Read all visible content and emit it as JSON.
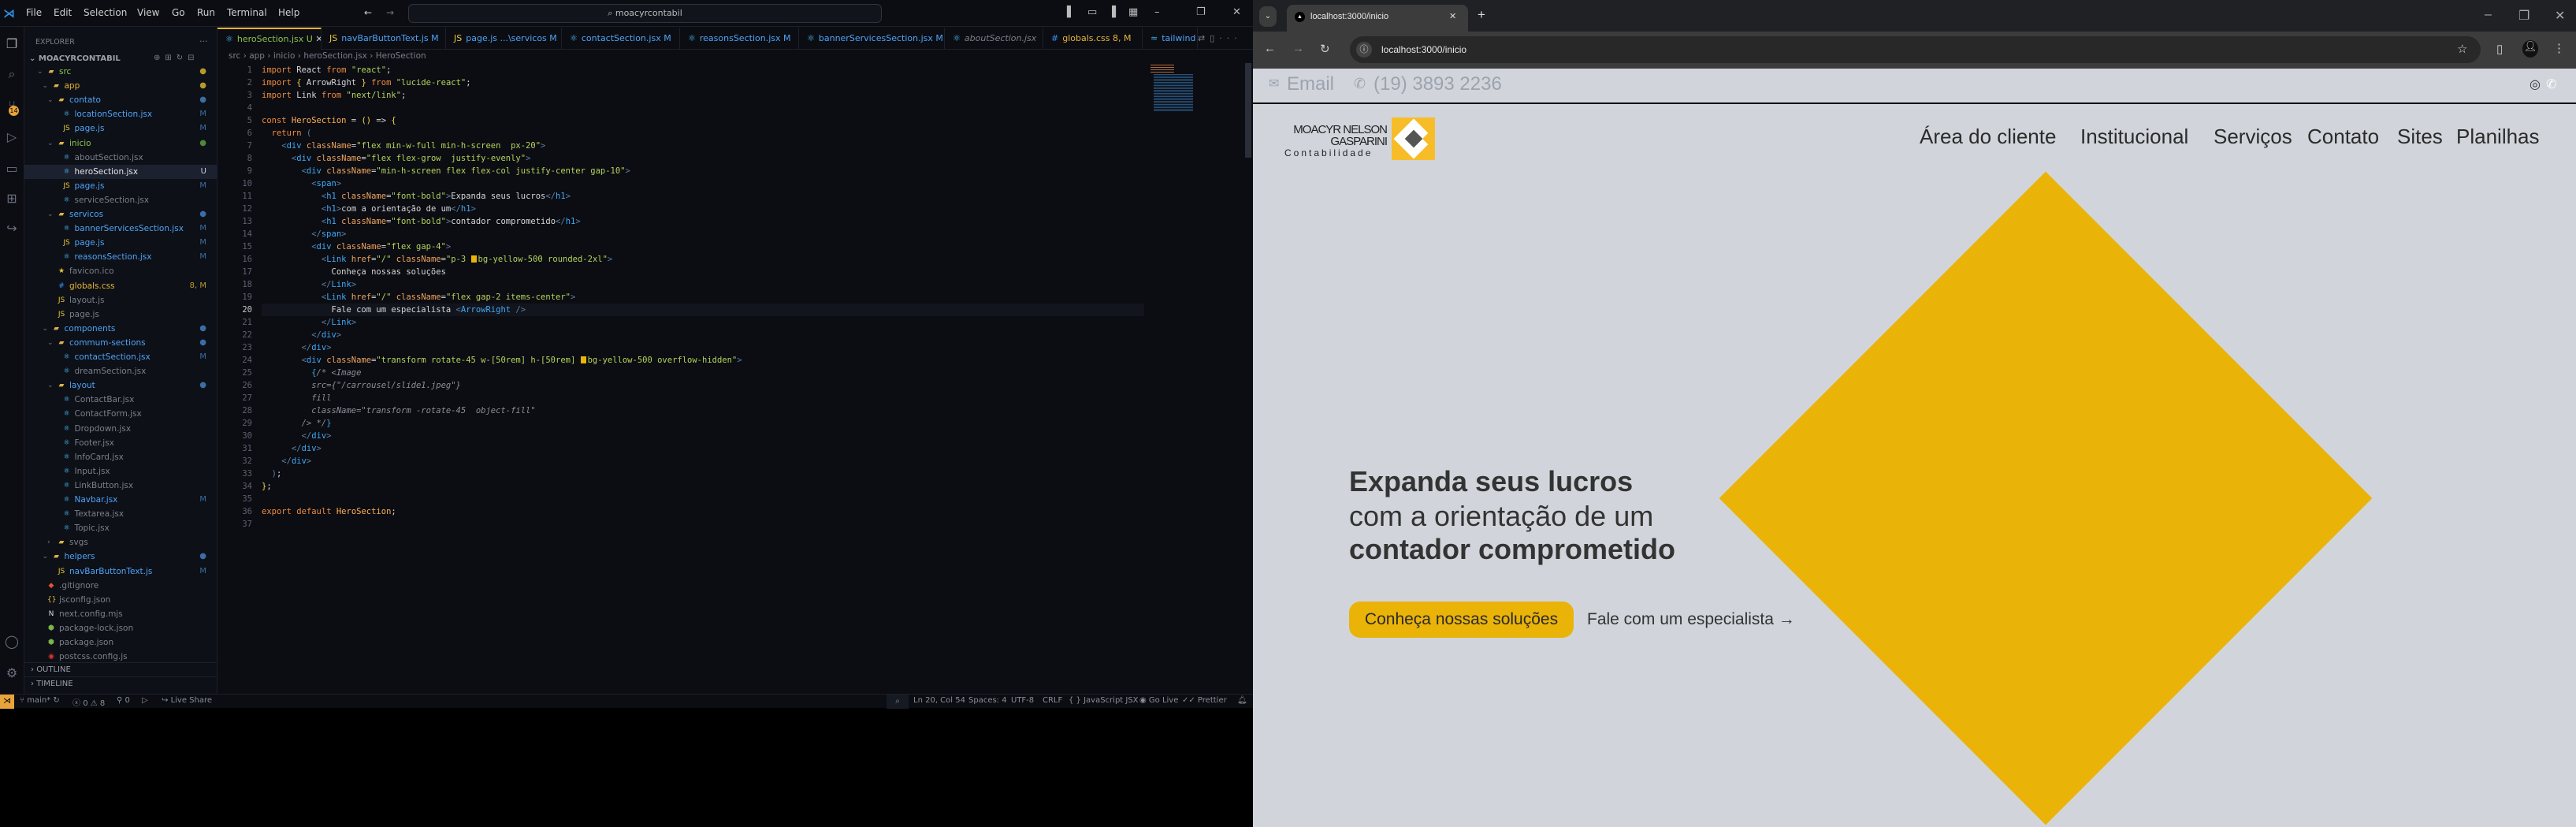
{
  "vscode": {
    "menu": [
      "File",
      "Edit",
      "Selection",
      "View",
      "Go",
      "Run",
      "Terminal",
      "Help"
    ],
    "command_center": "moacyrcontabil",
    "explorer_title": "EXPLORER",
    "project": "MOACYRCONTABIL",
    "tree": [
      {
        "label": "src",
        "depth": 0,
        "kind": "folder",
        "color": "#8bc34a",
        "badge": "●",
        "badge_color": "#b59a2a"
      },
      {
        "label": "app",
        "depth": 1,
        "kind": "folder",
        "color": "#e8b339",
        "badge": "●",
        "badge_color": "#b59a2a"
      },
      {
        "label": "contato",
        "depth": 2,
        "kind": "folder",
        "color": "#4fa3f7",
        "badge": "●",
        "badge_color": "#3a6ea5"
      },
      {
        "label": "locationSection.jsx",
        "depth": 3,
        "kind": "jsx",
        "color": "#4fa3f7",
        "badge": "M",
        "badge_color": "#3a6ea5"
      },
      {
        "label": "page.js",
        "depth": 3,
        "kind": "js",
        "color": "#4fa3f7",
        "badge": "M",
        "badge_color": "#3a6ea5"
      },
      {
        "label": "inicio",
        "depth": 2,
        "kind": "folder",
        "color": "#8bc34a",
        "badge": "●",
        "badge_color": "#4c8a3a"
      },
      {
        "label": "aboutSection.jsx",
        "depth": 3,
        "kind": "jsx",
        "color": "#7a7f8a",
        "badge": "",
        "badge_color": ""
      },
      {
        "label": "heroSection.jsx",
        "depth": 3,
        "kind": "jsx",
        "color": "#e6e6e6",
        "badge": "U",
        "badge_color": "#cfcfcf",
        "selected": true
      },
      {
        "label": "page.js",
        "depth": 3,
        "kind": "js",
        "color": "#4fa3f7",
        "badge": "M",
        "badge_color": "#3a6ea5"
      },
      {
        "label": "serviceSection.jsx",
        "depth": 3,
        "kind": "jsx",
        "color": "#7a7f8a",
        "badge": "",
        "badge_color": ""
      },
      {
        "label": "servicos",
        "depth": 2,
        "kind": "folder",
        "color": "#4fa3f7",
        "badge": "●",
        "badge_color": "#3a6ea5"
      },
      {
        "label": "bannerServicesSection.jsx",
        "depth": 3,
        "kind": "jsx",
        "color": "#4fa3f7",
        "badge": "M",
        "badge_color": "#3a6ea5"
      },
      {
        "label": "page.js",
        "depth": 3,
        "kind": "js",
        "color": "#4fa3f7",
        "badge": "M",
        "badge_color": "#3a6ea5"
      },
      {
        "label": "reasonsSection.jsx",
        "depth": 3,
        "kind": "jsx",
        "color": "#4fa3f7",
        "badge": "M",
        "badge_color": "#3a6ea5"
      },
      {
        "label": "favicon.ico",
        "depth": 2,
        "kind": "star",
        "color": "#7a7f8a",
        "badge": "",
        "badge_color": ""
      },
      {
        "label": "globals.css",
        "depth": 2,
        "kind": "css",
        "color": "#e8b339",
        "badge": "8, M",
        "badge_color": "#b59a2a"
      },
      {
        "label": "layout.js",
        "depth": 2,
        "kind": "js",
        "color": "#7a7f8a",
        "badge": "",
        "badge_color": ""
      },
      {
        "label": "page.js",
        "depth": 2,
        "kind": "js",
        "color": "#7a7f8a",
        "badge": "",
        "badge_color": ""
      },
      {
        "label": "components",
        "depth": 1,
        "kind": "folder",
        "color": "#4fa3f7",
        "badge": "●",
        "badge_color": "#3a6ea5"
      },
      {
        "label": "commum-sections",
        "depth": 2,
        "kind": "folder",
        "color": "#4fa3f7",
        "badge": "●",
        "badge_color": "#3a6ea5"
      },
      {
        "label": "contactSection.jsx",
        "depth": 3,
        "kind": "jsx",
        "color": "#4fa3f7",
        "badge": "M",
        "badge_color": "#3a6ea5"
      },
      {
        "label": "dreamSection.jsx",
        "depth": 3,
        "kind": "jsx",
        "color": "#7a7f8a",
        "badge": "",
        "badge_color": ""
      },
      {
        "label": "layout",
        "depth": 2,
        "kind": "folder",
        "color": "#4fa3f7",
        "badge": "●",
        "badge_color": "#3a6ea5"
      },
      {
        "label": "ContactBar.jsx",
        "depth": 3,
        "kind": "jsx",
        "color": "#7a7f8a",
        "badge": "",
        "badge_color": ""
      },
      {
        "label": "ContactForm.jsx",
        "depth": 3,
        "kind": "jsx",
        "color": "#7a7f8a",
        "badge": "",
        "badge_color": ""
      },
      {
        "label": "Dropdown.jsx",
        "depth": 3,
        "kind": "jsx",
        "color": "#7a7f8a",
        "badge": "",
        "badge_color": ""
      },
      {
        "label": "Footer.jsx",
        "depth": 3,
        "kind": "jsx",
        "color": "#7a7f8a",
        "badge": "",
        "badge_color": ""
      },
      {
        "label": "InfoCard.jsx",
        "depth": 3,
        "kind": "jsx",
        "color": "#7a7f8a",
        "badge": "",
        "badge_color": ""
      },
      {
        "label": "Input.jsx",
        "depth": 3,
        "kind": "jsx",
        "color": "#7a7f8a",
        "badge": "",
        "badge_color": ""
      },
      {
        "label": "LinkButton.jsx",
        "depth": 3,
        "kind": "jsx",
        "color": "#7a7f8a",
        "badge": "",
        "badge_color": ""
      },
      {
        "label": "Navbar.jsx",
        "depth": 3,
        "kind": "jsx",
        "color": "#4fa3f7",
        "badge": "M",
        "badge_color": "#3a6ea5"
      },
      {
        "label": "Textarea.jsx",
        "depth": 3,
        "kind": "jsx",
        "color": "#7a7f8a",
        "badge": "",
        "badge_color": ""
      },
      {
        "label": "Topic.jsx",
        "depth": 3,
        "kind": "jsx",
        "color": "#7a7f8a",
        "badge": "",
        "badge_color": ""
      },
      {
        "label": "svgs",
        "depth": 2,
        "kind": "folder-closed",
        "color": "#7a7f8a",
        "badge": "",
        "badge_color": ""
      },
      {
        "label": "helpers",
        "depth": 1,
        "kind": "folder",
        "color": "#4fa3f7",
        "badge": "●",
        "badge_color": "#3a6ea5"
      },
      {
        "label": "navBarButtonText.js",
        "depth": 2,
        "kind": "js",
        "color": "#4fa3f7",
        "badge": "M",
        "badge_color": "#3a6ea5"
      },
      {
        "label": ".gitignore",
        "depth": 0,
        "kind": "git",
        "color": "#7a7f8a",
        "badge": "",
        "badge_color": ""
      },
      {
        "label": "jsconfig.json",
        "depth": 0,
        "kind": "json",
        "color": "#7a7f8a",
        "badge": "",
        "badge_color": ""
      },
      {
        "label": "next.config.mjs",
        "depth": 0,
        "kind": "next",
        "color": "#7a7f8a",
        "badge": "",
        "badge_color": ""
      },
      {
        "label": "package-lock.json",
        "depth": 0,
        "kind": "npm",
        "color": "#7a7f8a",
        "badge": "",
        "badge_color": ""
      },
      {
        "label": "package.json",
        "depth": 0,
        "kind": "npm",
        "color": "#7a7f8a",
        "badge": "",
        "badge_color": ""
      },
      {
        "label": "postcss.config.js",
        "depth": 0,
        "kind": "postcss",
        "color": "#7a7f8a",
        "badge": "",
        "badge_color": ""
      }
    ],
    "outline": "OUTLINE",
    "timeline": "TIMELINE",
    "source_control_badge": "14",
    "tabs": [
      {
        "label": "heroSection.jsx U",
        "kind": "jsx",
        "color": "#8bc34a",
        "active": true
      },
      {
        "label": "navBarButtonText.js M",
        "kind": "js",
        "color": "#4fa3f7"
      },
      {
        "label": "page.js ...\\servicos M",
        "kind": "js",
        "color": "#4fa3f7"
      },
      {
        "label": "contactSection.jsx M",
        "kind": "jsx",
        "color": "#4fa3f7"
      },
      {
        "label": "reasonsSection.jsx M",
        "kind": "jsx",
        "color": "#4fa3f7"
      },
      {
        "label": "bannerServicesSection.jsx M",
        "kind": "jsx",
        "color": "#4fa3f7"
      },
      {
        "label": "aboutSection.jsx",
        "kind": "jsx",
        "color": "#7a7f8a"
      },
      {
        "label": "globals.css 8, M",
        "kind": "css",
        "color": "#e8b339"
      },
      {
        "label": "tailwind",
        "kind": "tw",
        "color": "#4fa3f7"
      }
    ],
    "breadcrumb": "src › app › inicio › heroSection.jsx › HeroSection",
    "code": [
      [
        [
          "import",
          "k"
        ],
        [
          " React ",
          "i"
        ],
        [
          "from",
          "k"
        ],
        [
          " \"react\"",
          "s"
        ],
        [
          ";",
          "i"
        ]
      ],
      [
        [
          "import",
          "k"
        ],
        [
          " ",
          "i"
        ],
        [
          "{",
          "y"
        ],
        [
          " ArrowRight ",
          "i"
        ],
        [
          "}",
          "y"
        ],
        [
          " ",
          "i"
        ],
        [
          "from",
          "k"
        ],
        [
          " \"lucide-react\"",
          "s"
        ],
        [
          ";",
          "i"
        ]
      ],
      [
        [
          "import",
          "k"
        ],
        [
          " Link ",
          "i"
        ],
        [
          "from",
          "k"
        ],
        [
          " \"next/link\"",
          "s"
        ],
        [
          ";",
          "i"
        ]
      ],
      [],
      [
        [
          "const",
          "k"
        ],
        [
          " HeroSection",
          "f"
        ],
        [
          " = ",
          "i"
        ],
        [
          "()",
          "y"
        ],
        [
          " => ",
          "i"
        ],
        [
          "{",
          "y"
        ]
      ],
      [
        [
          "  ",
          "i"
        ],
        [
          "return",
          "k"
        ],
        [
          " (",
          "p"
        ]
      ],
      [
        [
          "    <",
          "p"
        ],
        [
          "div",
          "t"
        ],
        [
          " className",
          "a"
        ],
        [
          "=",
          "i"
        ],
        [
          "\"flex min-w-full min-h-screen  px-20\"",
          "s"
        ],
        [
          ">",
          "p"
        ]
      ],
      [
        [
          "      <",
          "p"
        ],
        [
          "div",
          "t"
        ],
        [
          " className",
          "a"
        ],
        [
          "=",
          "i"
        ],
        [
          "\"flex flex-grow  justify-evenly\"",
          "s"
        ],
        [
          ">",
          "p"
        ]
      ],
      [
        [
          "        <",
          "p"
        ],
        [
          "div",
          "t"
        ],
        [
          " className",
          "a"
        ],
        [
          "=",
          "i"
        ],
        [
          "\"min-h-screen flex flex-col justify-center gap-10\"",
          "s"
        ],
        [
          ">",
          "p"
        ]
      ],
      [
        [
          "          <",
          "p"
        ],
        [
          "span",
          "t"
        ],
        [
          ">",
          "p"
        ]
      ],
      [
        [
          "            <",
          "p"
        ],
        [
          "h1",
          "t"
        ],
        [
          " className",
          "a"
        ],
        [
          "=",
          "i"
        ],
        [
          "\"font-bold\"",
          "s"
        ],
        [
          ">",
          "p"
        ],
        [
          "Expanda seus lucros",
          "x"
        ],
        [
          "</",
          "p"
        ],
        [
          "h1",
          "t"
        ],
        [
          ">",
          "p"
        ]
      ],
      [
        [
          "            <",
          "p"
        ],
        [
          "h1",
          "t"
        ],
        [
          ">",
          "p"
        ],
        [
          "com a orientação de um",
          "x"
        ],
        [
          "</",
          "p"
        ],
        [
          "h1",
          "t"
        ],
        [
          ">",
          "p"
        ]
      ],
      [
        [
          "            <",
          "p"
        ],
        [
          "h1",
          "t"
        ],
        [
          " className",
          "a"
        ],
        [
          "=",
          "i"
        ],
        [
          "\"font-bold\"",
          "s"
        ],
        [
          ">",
          "p"
        ],
        [
          "contador comprometido",
          "x"
        ],
        [
          "</",
          "p"
        ],
        [
          "h1",
          "t"
        ],
        [
          ">",
          "p"
        ]
      ],
      [
        [
          "          </",
          "p"
        ],
        [
          "span",
          "t"
        ],
        [
          ">",
          "p"
        ]
      ],
      [
        [
          "          <",
          "p"
        ],
        [
          "div",
          "t"
        ],
        [
          " className",
          "a"
        ],
        [
          "=",
          "i"
        ],
        [
          "\"flex gap-4\"",
          "s"
        ],
        [
          ">",
          "p"
        ]
      ],
      [
        [
          "            <",
          "p"
        ],
        [
          "Link",
          "t"
        ],
        [
          " href",
          "a"
        ],
        [
          "=",
          "i"
        ],
        [
          "\"/\"",
          "s"
        ],
        [
          " className",
          "a"
        ],
        [
          "=",
          "i"
        ],
        [
          "\"p-3 ",
          "s"
        ],
        [
          "",
          "sw"
        ],
        [
          "bg-yellow-500 rounded-2xl\"",
          "s"
        ],
        [
          ">",
          "p"
        ]
      ],
      [
        [
          "              Conheça nossas soluções",
          "x"
        ]
      ],
      [
        [
          "            </",
          "p"
        ],
        [
          "Link",
          "t"
        ],
        [
          ">",
          "p"
        ]
      ],
      [
        [
          "            <",
          "p"
        ],
        [
          "Link",
          "t"
        ],
        [
          " href",
          "a"
        ],
        [
          "=",
          "i"
        ],
        [
          "\"/\"",
          "s"
        ],
        [
          " className",
          "a"
        ],
        [
          "=",
          "i"
        ],
        [
          "\"flex gap-2 items-center\"",
          "s"
        ],
        [
          ">",
          "p"
        ]
      ],
      [
        [
          "              Fale com um especialista ",
          "x"
        ],
        [
          "<",
          "p"
        ],
        [
          "ArrowRight",
          "t"
        ],
        [
          " />",
          "p"
        ]
      ],
      [
        [
          "            </",
          "p"
        ],
        [
          "Link",
          "t"
        ],
        [
          ">",
          "p"
        ]
      ],
      [
        [
          "          </",
          "p"
        ],
        [
          "div",
          "t"
        ],
        [
          ">",
          "p"
        ]
      ],
      [
        [
          "        </",
          "p"
        ],
        [
          "div",
          "t"
        ],
        [
          ">",
          "p"
        ]
      ],
      [
        [
          "        <",
          "p"
        ],
        [
          "div",
          "t"
        ],
        [
          " className",
          "a"
        ],
        [
          "=",
          "i"
        ],
        [
          "\"transform rotate-45 w-[50rem] h-[50rem] ",
          "s"
        ],
        [
          "",
          "sw"
        ],
        [
          "bg-yellow-500 overflow-hidden\"",
          "s"
        ],
        [
          ">",
          "p"
        ]
      ],
      [
        [
          "          {",
          "t"
        ],
        [
          "/* <Image",
          "c"
        ]
      ],
      [
        [
          "          src={\"/carrousel/slide1.jpeg\"}",
          "c"
        ]
      ],
      [
        [
          "          fill",
          "c"
        ]
      ],
      [
        [
          "          className=\"transform -rotate-45  object-fill\"",
          "c"
        ]
      ],
      [
        [
          "        /> */",
          "c"
        ],
        [
          "}",
          "t"
        ]
      ],
      [
        [
          "        </",
          "p"
        ],
        [
          "div",
          "t"
        ],
        [
          ">",
          "p"
        ]
      ],
      [
        [
          "      </",
          "p"
        ],
        [
          "div",
          "t"
        ],
        [
          ">",
          "p"
        ]
      ],
      [
        [
          "    </",
          "p"
        ],
        [
          "div",
          "t"
        ],
        [
          ">",
          "p"
        ]
      ],
      [
        [
          "  )",
          "p"
        ],
        [
          ";",
          "i"
        ]
      ],
      [
        [
          "}",
          "y"
        ],
        [
          ";",
          "i"
        ]
      ],
      [],
      [
        [
          "export",
          "k"
        ],
        [
          " ",
          "i"
        ],
        [
          "default",
          "k"
        ],
        [
          " HeroSection",
          "f"
        ],
        [
          ";",
          "i"
        ]
      ],
      []
    ],
    "current_line": 20,
    "status_left": {
      "branch": "main*",
      "errors": "0",
      "warnings": "8",
      "ports": "0",
      "live_share": "Live Share"
    },
    "status_right": [
      "Ln 20, Col 54",
      "Spaces: 4",
      "UTF-8",
      "CRLF",
      "{ } JavaScript JSX",
      "Go Live",
      "✓✓ Prettier"
    ]
  },
  "browser": {
    "tab_title": "localhost:3000/inicio",
    "url": "localhost:3000/inicio",
    "page": {
      "contact": {
        "email": "Email",
        "phone": "(19) 3893 2236"
      },
      "logo": {
        "line1": "MOACYR NELSON",
        "line2": "GASPARINI",
        "line3": "Contabilidade"
      },
      "nav": [
        "Área do cliente",
        "Institucional",
        "Serviços",
        "Contato",
        "Sites",
        "Planilhas"
      ],
      "hero": {
        "lines": [
          "Expanda seus lucros",
          "com a orientação de um",
          "contador comprometido"
        ],
        "primary_cta": "Conheça nossas soluções",
        "secondary_cta": "Fale com um especialista"
      },
      "colors": {
        "accent": "#eab308",
        "background": "#d1d5db"
      }
    }
  }
}
